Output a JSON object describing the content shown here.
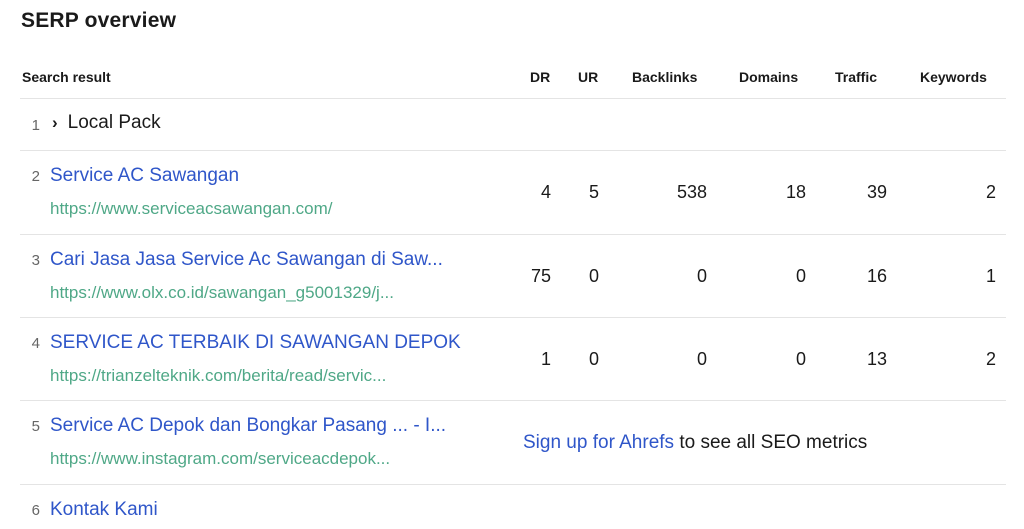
{
  "page": {
    "title": "SERP overview"
  },
  "table": {
    "headers": {
      "result": "Search result",
      "dr": "DR",
      "ur": "UR",
      "backlinks": "Backlinks",
      "domains": "Domains",
      "traffic": "Traffic",
      "keywords": "Keywords"
    },
    "rows": [
      {
        "num": "1",
        "label": "Local Pack",
        "chevron": "›"
      },
      {
        "num": "2",
        "title": "Service AC Sawangan",
        "url": "https://www.serviceacsawangan.com/",
        "dr": "4",
        "ur": "5",
        "backlinks": "538",
        "domains": "18",
        "traffic": "39",
        "keywords": "2"
      },
      {
        "num": "3",
        "title": "Cari Jasa Jasa Service Ac Sawangan di Saw...",
        "url": "https://www.olx.co.id/sawangan_g5001329/j...",
        "dr": "75",
        "ur": "0",
        "backlinks": "0",
        "domains": "0",
        "traffic": "16",
        "keywords": "1"
      },
      {
        "num": "4",
        "title": "SERVICE AC TERBAIK DI SAWANGAN DEPOK",
        "url": "https://trianzelteknik.com/berita/read/servic...",
        "dr": "1",
        "ur": "0",
        "backlinks": "0",
        "domains": "0",
        "traffic": "13",
        "keywords": "2"
      },
      {
        "num": "5",
        "title": "Service AC Depok dan Bongkar Pasang ... - I...",
        "url": "https://www.instagram.com/serviceacdepok...",
        "signup_link": "Sign up for Ahrefs",
        "signup_text": " to see all SEO metrics"
      },
      {
        "num": "6",
        "title": "Kontak Kami"
      }
    ]
  },
  "colors": {
    "title_link": "#2f56c9",
    "url": "#4fa887",
    "divider": "#e4e4e4"
  }
}
